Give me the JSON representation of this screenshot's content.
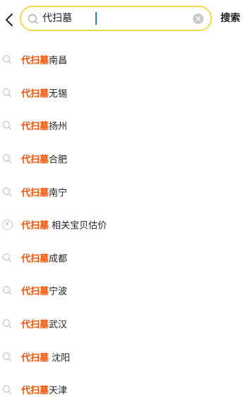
{
  "header": {
    "back_icon": "chevron-left-icon",
    "search_value": "代扫墓",
    "search_button_label": "搜索",
    "accent_border": "#f3d94a"
  },
  "suggestions": [
    {
      "icon": "search-icon",
      "highlight": "代扫墓",
      "rest": "南昌"
    },
    {
      "icon": "search-icon",
      "highlight": "代扫墓",
      "rest": "无锡"
    },
    {
      "icon": "search-icon",
      "highlight": "代扫墓",
      "rest": "扬州"
    },
    {
      "icon": "search-icon",
      "highlight": "代扫墓",
      "rest": "合肥"
    },
    {
      "icon": "search-icon",
      "highlight": "代扫墓",
      "rest": "南宁"
    },
    {
      "icon": "yuan-icon",
      "highlight": "代扫墓",
      "rest": " 相关宝贝估价"
    },
    {
      "icon": "search-icon",
      "highlight": "代扫墓",
      "rest": "成都"
    },
    {
      "icon": "search-icon",
      "highlight": "代扫墓",
      "rest": "宁波"
    },
    {
      "icon": "search-icon",
      "highlight": "代扫墓",
      "rest": "武汉"
    },
    {
      "icon": "search-icon",
      "highlight": "代扫墓",
      "rest": " 沈阳"
    },
    {
      "icon": "search-icon",
      "highlight": "代扫墓",
      "rest": "天津"
    }
  ],
  "colors": {
    "highlight": "#ff5000",
    "caret": "#2c7be5"
  }
}
